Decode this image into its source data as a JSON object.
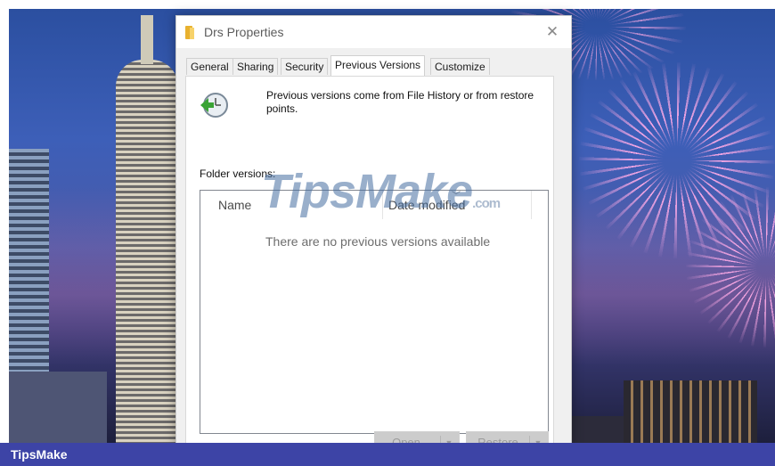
{
  "dialog": {
    "title": "Drs Properties",
    "close_glyph": "✕",
    "tabs": [
      {
        "label": "General",
        "active": false
      },
      {
        "label": "Sharing",
        "active": false
      },
      {
        "label": "Security",
        "active": false
      },
      {
        "label": "Previous Versions",
        "active": true
      },
      {
        "label": "Customize",
        "active": false
      }
    ],
    "info_text": "Previous versions come from File History or from restore points.",
    "folder_versions_label": "Folder versions:",
    "columns": {
      "name": "Name",
      "date_modified": "Date modified"
    },
    "empty_message": "There are no previous versions available",
    "buttons": {
      "open": "Open",
      "restore": "Restore"
    }
  },
  "watermark": {
    "text": "TipsMake",
    "suffix": ".com"
  },
  "footer": {
    "brand": "TipsMake"
  },
  "colors": {
    "footer_bar": "#3d44a6",
    "folder_icon": "#e8b12f",
    "clock_icon_green": "#3aa335"
  }
}
